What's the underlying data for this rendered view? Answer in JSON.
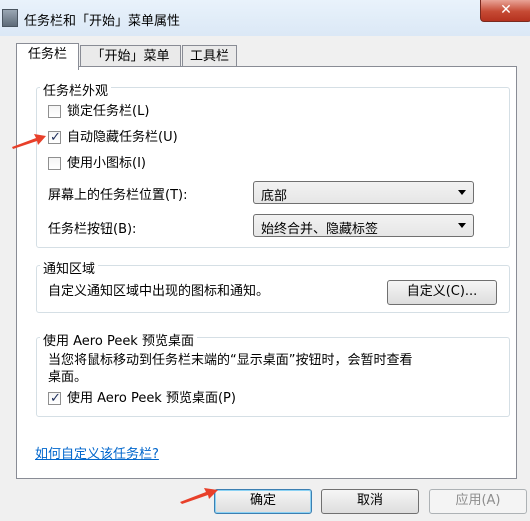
{
  "window": {
    "title": "任务栏和「开始」菜单属性",
    "close_label": "✕"
  },
  "tabs": [
    {
      "label": "任务栏"
    },
    {
      "label": "「开始」菜单"
    },
    {
      "label": "工具栏"
    }
  ],
  "appearance": {
    "legend": "任务栏外观",
    "lock_taskbar": {
      "label": "锁定任务栏(L)",
      "checked": false
    },
    "auto_hide": {
      "label": "自动隐藏任务栏(U)",
      "checked": true
    },
    "small_icons": {
      "label": "使用小图标(I)",
      "checked": false
    },
    "location_label": "屏幕上的任务栏位置(T):",
    "location_value": "底部",
    "buttons_label": "任务栏按钮(B):",
    "buttons_value": "始终合并、隐藏标签"
  },
  "notification": {
    "legend": "通知区域",
    "text": "自定义通知区域中出现的图标和通知。",
    "customize_label": "自定义(C)..."
  },
  "aero_peek": {
    "legend": "使用 Aero Peek 预览桌面",
    "desc_line1": "当您将鼠标移动到任务栏末端的“显示桌面”按钮时，会暂时查看",
    "desc_line2": "桌面。",
    "checkbox_label": "使用 Aero Peek 预览桌面(P)",
    "checked": true
  },
  "help_link": "如何自定义该任务栏?",
  "footer": {
    "ok_label": "确定",
    "cancel_label": "取消",
    "apply_label": "应用(A)"
  },
  "colors": {
    "annotation_arrow": "#e8402a",
    "link": "#0066cc",
    "accent": "#3c7fb1"
  }
}
